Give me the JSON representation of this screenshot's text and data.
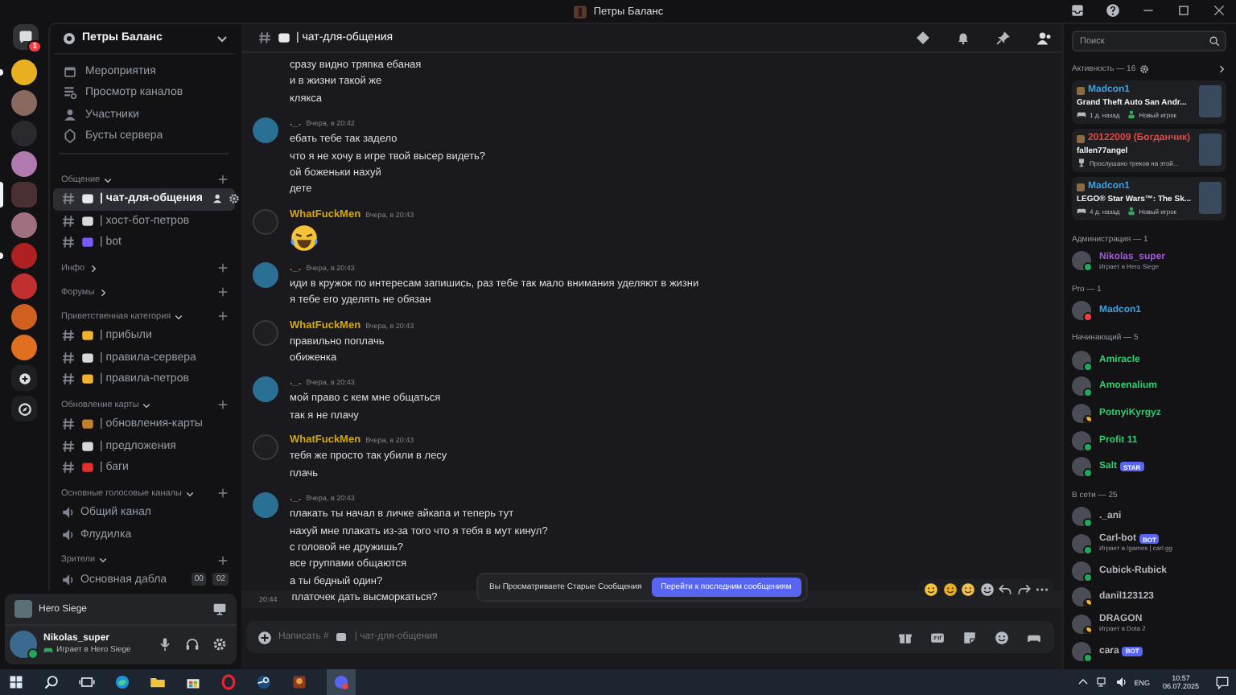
{
  "window": {
    "title": "Петры Баланс"
  },
  "server_rail": {
    "home_badge": "1",
    "servers": [
      {
        "color": "#e8b020",
        "unread": true,
        "selected": false
      },
      {
        "color": "#8a6a60",
        "unread": false,
        "selected": false
      },
      {
        "color": "#2a2a2e",
        "unread": false,
        "selected": false
      },
      {
        "color": "#b07ab0",
        "unread": false,
        "selected": false
      },
      {
        "color": "#4a3030",
        "unread": false,
        "selected": true
      },
      {
        "color": "#a07080",
        "unread": false,
        "selected": false
      },
      {
        "color": "#b02020",
        "unread": true,
        "selected": false
      },
      {
        "color": "#c03030",
        "unread": false,
        "selected": false
      },
      {
        "color": "#d06020",
        "unread": false,
        "selected": false
      },
      {
        "color": "#e07020",
        "unread": false,
        "selected": false
      }
    ]
  },
  "server": {
    "name": "Петры Баланс"
  },
  "server_menu": [
    {
      "kind": "events",
      "label": "Мероприятия"
    },
    {
      "kind": "browse",
      "label": "Просмотр каналов"
    },
    {
      "kind": "members",
      "label": "Участники"
    },
    {
      "kind": "boosts",
      "label": "Бусты сервера"
    }
  ],
  "categories": [
    {
      "name": "Общение",
      "expanded": true,
      "channels": [
        {
          "kind": "text",
          "color": "#e8e8e8",
          "name": "| чат-для-общения",
          "selected": true
        },
        {
          "kind": "text",
          "color": "#d8d8d8",
          "name": "| хост-бот-петров",
          "selected": false
        },
        {
          "kind": "text",
          "color": "#7a5af8",
          "name": "| bot",
          "selected": false
        }
      ]
    },
    {
      "name": "Инфо",
      "expanded": false
    },
    {
      "name": "Форумы",
      "expanded": false
    },
    {
      "name": "Приветственная категория",
      "expanded": true,
      "channels": [
        {
          "kind": "text",
          "color": "#f0b232",
          "name": "| прибыли",
          "selected": false
        },
        {
          "kind": "text",
          "color": "#d8d8d8",
          "name": "| правила-сервера",
          "selected": false
        },
        {
          "kind": "text",
          "color": "#f0b232",
          "name": "| правила-петров",
          "selected": false
        }
      ]
    },
    {
      "name": "Обновление карты",
      "expanded": true,
      "channels": [
        {
          "kind": "text",
          "color": "#c08030",
          "name": "| обновления-карты",
          "selected": false
        },
        {
          "kind": "text",
          "color": "#d8d8d8",
          "name": "| предложения",
          "selected": false
        },
        {
          "kind": "text",
          "color": "#e03030",
          "name": "| баги",
          "selected": false
        }
      ]
    },
    {
      "name": "Основные голосовые каналы",
      "expanded": true,
      "channels": [
        {
          "kind": "voice",
          "name": "Общий канал",
          "selected": false
        },
        {
          "kind": "voice",
          "name": "Флудилка",
          "selected": false
        }
      ]
    },
    {
      "name": "Зрители",
      "expanded": true,
      "channels": [
        {
          "kind": "voice",
          "name": "Основная дабла",
          "selected": false,
          "counters": [
            "00",
            "02"
          ]
        }
      ]
    }
  ],
  "activity_panel": {
    "game": "Hero Siege"
  },
  "user_panel": {
    "name": "Nikolas_super",
    "status": "Играет в Hero Siege"
  },
  "chat": {
    "channel": "| чат-для-общения",
    "messages": [
      {
        "kind": "continuation",
        "lines": [
          "сразу видно тряпка ебаная",
          "и в жизни такой же",
          "клякса"
        ]
      },
      {
        "kind": "text",
        "author": "._.",
        "color": "#b0683a",
        "time": "Вчера, в 20:42",
        "lines": [
          "ебать тебе так задело",
          "что я не хочу в игре твой высер видеть?",
          "ой боженьки нахуй",
          "дете"
        ]
      },
      {
        "kind": "emoji",
        "author": "WhatFuckMen",
        "color": "#d4a800",
        "time": "Вчера, в 20:43"
      },
      {
        "kind": "text",
        "author": "._.",
        "color": "#b0683a",
        "time": "Вчера, в 20:43",
        "lines": [
          "иди в кружок по интересам запишись, раз тебе так мало внимания уделяют в жизни",
          "я тебе его уделять не обязан"
        ]
      },
      {
        "kind": "text",
        "author": "WhatFuckMen",
        "color": "#d4a800",
        "time": "Вчера, в 20:43",
        "lines": [
          "правильно поплачь",
          "обиженка"
        ]
      },
      {
        "kind": "text",
        "author": "._.",
        "color": "#b0683a",
        "time": "Вчера, в 20:43",
        "lines": [
          "мой право с кем мне общаться",
          "так я не плачу"
        ]
      },
      {
        "kind": "text",
        "author": "WhatFuckMen",
        "color": "#d4a800",
        "time": "Вчера, в 20:43",
        "lines": [
          "тебя же просто так убили в лесу",
          "плачь"
        ]
      },
      {
        "kind": "text",
        "author": "._.",
        "color": "#b0683a",
        "time": "Вчера, в 20:43",
        "lines": [
          "плакать ты начал в личке айкапа и теперь тут",
          "нахуй мне плакать из-за того что я тебя в мут кинул?",
          "с головой не дружишь?",
          "все группами общаются",
          "а ты бедный один?"
        ]
      }
    ],
    "hover_line": {
      "time": "20:44",
      "text": "платочек дать высморкаться?"
    },
    "jump_bar": {
      "text": "Вы Просматриваете Старые Сообщения",
      "button": "Перейти к последним сообщениям"
    },
    "input": {
      "prefix": "Написать #",
      "channel": "| чат-для-общения"
    }
  },
  "search": {
    "placeholder": "Поиск"
  },
  "activity": {
    "title": "Активность — 16",
    "cards": [
      {
        "name": "Madcon1",
        "color": "#3fa0e0",
        "game": "Grand Theft Auto San Andr...",
        "meta": [
          {
            "kind": "time",
            "text": "1 д. назад"
          },
          {
            "kind": "new",
            "text": "Новый игрок"
          }
        ]
      },
      {
        "name": "20122009 (Богданчик)",
        "color": "#e04848",
        "game": "fallen77angel",
        "meta": [
          {
            "kind": "trophy",
            "text": "Прослушано треков на этой..."
          }
        ]
      },
      {
        "name": "Madcon1",
        "color": "#3fa0e0",
        "game": "LEGO® Star Wars™: The Sk...",
        "meta": [
          {
            "kind": "time",
            "text": "4 д. назад"
          },
          {
            "kind": "new",
            "text": "Новый игрок"
          }
        ]
      }
    ]
  },
  "member_groups": [
    {
      "title": "Администрация — 1",
      "members": [
        {
          "name": "Nikolas_super",
          "color": "#a05ad8",
          "idle": false,
          "dnd": false,
          "activity": "Играет в Hero Siege"
        }
      ]
    },
    {
      "title": "Pro — 1",
      "members": [
        {
          "name": "Madcon1",
          "color": "#3fa0e0",
          "idle": false,
          "dnd": true
        }
      ]
    },
    {
      "title": "Начинающий — 5",
      "members": [
        {
          "name": "Amiracle",
          "color": "#2ecc71",
          "idle": false,
          "dnd": false
        },
        {
          "name": "Amoenalium",
          "color": "#2ecc71",
          "idle": false,
          "dnd": false
        },
        {
          "name": "PotnyiKyrgyz",
          "color": "#2ecc71",
          "idle": true,
          "dnd": false
        },
        {
          "name": "Profit 11",
          "color": "#2ecc71",
          "idle": false,
          "dnd": false
        },
        {
          "name": "Salt",
          "color": "#2ecc71",
          "idle": false,
          "dnd": false,
          "tag": "STAR"
        }
      ]
    },
    {
      "title": "В сети — 25",
      "members": [
        {
          "name": "._ani",
          "color": "#b5b5bd",
          "idle": false,
          "dnd": false
        },
        {
          "name": "Carl-bot",
          "color": "#b5b5bd",
          "idle": false,
          "dnd": false,
          "tag": "BOT",
          "activity": "Играет в /games | carl.gg"
        },
        {
          "name": "Cubick-Rubick",
          "color": "#b5b5bd",
          "idle": false,
          "dnd": false
        },
        {
          "name": "danil123123",
          "color": "#b5b5bd",
          "idle": true,
          "dnd": false
        },
        {
          "name": "DRAGON",
          "color": "#b5b5bd",
          "idle": true,
          "dnd": false,
          "activity": "Играет в Dota 2"
        },
        {
          "name": "cara",
          "color": "#b5b5bd",
          "idle": false,
          "dnd": false,
          "tag": "BOT"
        }
      ]
    }
  ],
  "taskbar": {
    "language": "ENG",
    "time": "10:57",
    "date": "06.07.2025"
  }
}
